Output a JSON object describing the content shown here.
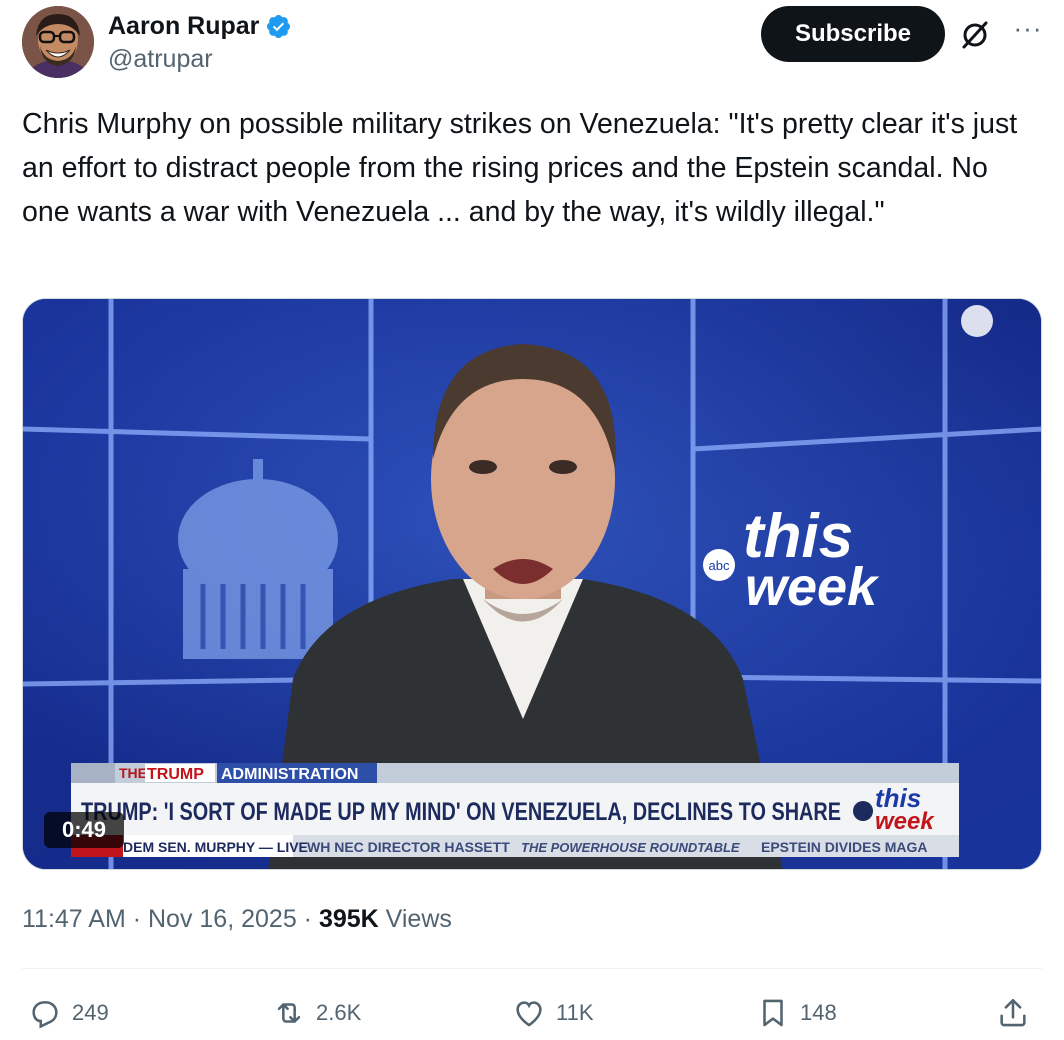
{
  "author": {
    "name": "Aaron Rupar",
    "handle": "@atrupar"
  },
  "subscribe_label": "Subscribe",
  "more_label": "···",
  "tweet_text": "Chris Murphy on possible military strikes on Venezuela: \"It's pretty clear it's just an effort to distract people from the rising prices and the Epstein scandal. No one wants a war with Venezuela ... and by the way, it's wildly illegal.\"",
  "video": {
    "duration": "0:49",
    "show_title_line1": "this",
    "show_title_line2": "week",
    "network": "abc",
    "banner_top_the": "THE",
    "banner_top_trump": "TRUMP",
    "banner_top_admin": "ADMINISTRATION",
    "headline": "TRUMP: 'I SORT OF MADE UP MY MIND' ON VENEZUELA, DECLINES TO SHARE",
    "ticker": [
      "DEM SEN. MURPHY — LIVE",
      "WH NEC DIRECTOR HASSETT",
      "THE POWERHOUSE ROUNDTABLE",
      "EPSTEIN DIVIDES MAGA"
    ]
  },
  "meta": {
    "time": "11:47 AM",
    "sep1": " · ",
    "date": "Nov 16, 2025",
    "sep2": " · ",
    "views_count": "395K",
    "views_label": " Views"
  },
  "actions": {
    "replies": "249",
    "reposts": "2.6K",
    "likes": "11K",
    "bookmarks": "148"
  },
  "colors": {
    "accent": "#1d9bf0",
    "text": "#0f1419",
    "secondary": "#536471",
    "video_blue": "#1b3aa8"
  }
}
